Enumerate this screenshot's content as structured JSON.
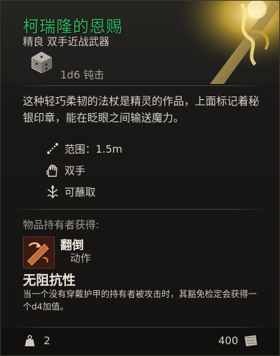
{
  "item": {
    "name": "柯瑞隆的恩赐",
    "subtitle": "精良 双手近战武器",
    "damage": "1d6 钝击",
    "description": "这种轻巧柔韧的法杖是精灵的作品，上面标记着秘银印章，能在眨眼之间输送魔力。",
    "properties": [
      {
        "icon": "range-icon",
        "label": "范围：1.5m"
      },
      {
        "icon": "two-hands-icon",
        "label": "双手"
      },
      {
        "icon": "dippable-icon",
        "label": "可蘸取"
      }
    ],
    "granted_label": "物品持有者获得:",
    "action": {
      "name": "翻倒",
      "type": "动作",
      "icon": "topple-icon"
    },
    "passive": {
      "name": "无阻抗性",
      "description": "当一个没有穿戴护甲的持有者被攻击时，其豁免检定会获得一个d4加值。"
    },
    "weight": "2",
    "price": "400"
  },
  "colors": {
    "title": "#2fb85a",
    "background": "#181716",
    "text": "#d8d3c8"
  }
}
